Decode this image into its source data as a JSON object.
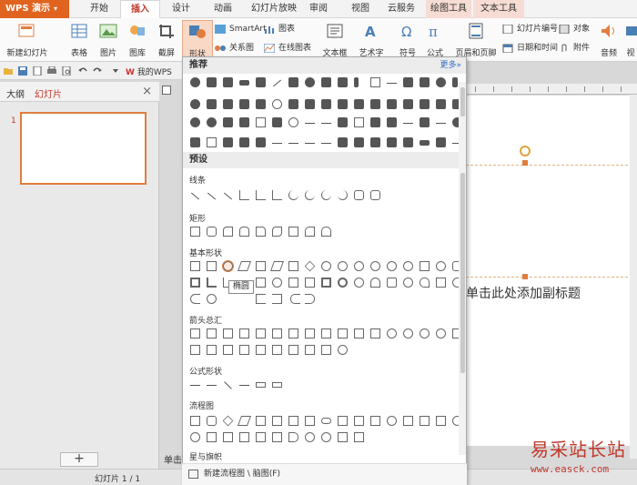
{
  "app": {
    "name": "WPS 演示",
    "arrow": "▾"
  },
  "menu_tabs": [
    "开始",
    "插入",
    "设计",
    "动画",
    "幻灯片放映",
    "审阅",
    "视图",
    "云服务",
    "绘图工具",
    "文本工具"
  ],
  "ribbon": {
    "new_slide": "新建幻灯片",
    "table": "表格",
    "picture": "图片",
    "gallery": "图库",
    "screenshot": "截屏",
    "shapes": "形状",
    "smartart": "SmartArt",
    "chart": "图表",
    "relation": "关系图",
    "online_chart": "在线图表",
    "textbox": "文本框",
    "wordart": "艺术字",
    "symbol": "符号",
    "formula": "公式",
    "header_footer": "页眉和页脚",
    "slide_number": "幻灯片编号",
    "object": "对象",
    "date_time": "日期和时间",
    "attachment": "附件",
    "audio": "音频",
    "video": "视"
  },
  "quick_access": {
    "mywps": "我的WPS"
  },
  "left_pane": {
    "tab_outline": "大纲",
    "tab_slides": "幻灯片",
    "slide_number": "1",
    "add_button": "+"
  },
  "status": {
    "slide_counter": "幻灯片 1 / 1"
  },
  "notes": {
    "placeholder": "单击"
  },
  "slide": {
    "subtitle_placeholder": "单击此处添加副标题"
  },
  "shapes_panel": {
    "recommended": "推荐",
    "more": "更多»",
    "preset": "预设",
    "categories": {
      "lines": "线条",
      "rectangles": "矩形",
      "basic": "基本形状",
      "arrows": "箭头总汇",
      "equation": "公式形状",
      "flowchart": "流程图",
      "stars": "星与旗帜"
    },
    "tooltip": "椭圆",
    "footer": "新建流程图 \\ 脑图(F)"
  },
  "watermark": {
    "title": "易采站长站",
    "url": "www.easck.com"
  }
}
